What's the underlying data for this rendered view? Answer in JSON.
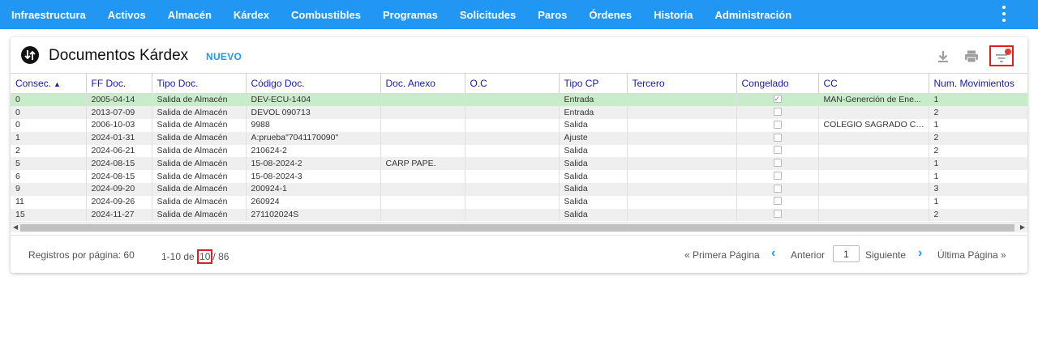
{
  "nav": {
    "items": [
      "Infraestructura",
      "Activos",
      "Almacén",
      "Kárdex",
      "Combustibles",
      "Programas",
      "Solicitudes",
      "Paros",
      "Órdenes",
      "Historia",
      "Administración"
    ]
  },
  "header": {
    "title": "Documentos Kárdex",
    "new_label": "NUEVO"
  },
  "table": {
    "columns": [
      "Consec.",
      "FF Doc.",
      "Tipo Doc.",
      "Código Doc.",
      "Doc. Anexo",
      "O.C",
      "Tipo CP",
      "Tercero",
      "Congelado",
      "CC",
      "Num. Movimientos"
    ],
    "rows": [
      [
        "0",
        "2005-04-14",
        "Salida de Almacén",
        "DEV-ECU-1404",
        "",
        "",
        "Entrada",
        "",
        true,
        "MAN-Generción de Ene...",
        "1"
      ],
      [
        "0",
        "2013-07-09",
        "Salida de Almacén",
        "DEVOL 090713",
        "",
        "",
        "Entrada",
        "",
        false,
        "",
        "2"
      ],
      [
        "0",
        "2006-10-03",
        "Salida de Almacén",
        "9988",
        "",
        "",
        "Salida",
        "",
        false,
        "COLEGIO SAGRADO CO...",
        "1"
      ],
      [
        "1",
        "2024-01-31",
        "Salida de Almacén",
        "A:prueba\"7041170090\"",
        "",
        "",
        "Ajuste",
        "",
        false,
        "",
        "2"
      ],
      [
        "2",
        "2024-06-21",
        "Salida de Almacén",
        "210624-2",
        "",
        "",
        "Salida",
        "",
        false,
        "",
        "2"
      ],
      [
        "5",
        "2024-08-15",
        "Salida de Almacén",
        "15-08-2024-2",
        "CARP PAPE.",
        "",
        "Salida",
        "",
        false,
        "",
        "1"
      ],
      [
        "6",
        "2024-08-15",
        "Salida de Almacén",
        "15-08-2024-3",
        "",
        "",
        "Salida",
        "",
        false,
        "",
        "1"
      ],
      [
        "9",
        "2024-09-20",
        "Salida de Almacén",
        "200924-1",
        "",
        "",
        "Salida",
        "",
        false,
        "",
        "3"
      ],
      [
        "11",
        "2024-09-26",
        "Salida de Almacén",
        "260924",
        "",
        "",
        "Salida",
        "",
        false,
        "",
        "1"
      ],
      [
        "15",
        "2024-11-27",
        "Salida de Almacén",
        "271102024S",
        "",
        "",
        "Salida",
        "",
        false,
        "",
        "2"
      ]
    ]
  },
  "pager": {
    "per_page": "Registros por página: 60",
    "range_start": "1-10 de ",
    "range_highlight": "10",
    "range_end": "/ 86",
    "first": "« Primera Página",
    "prev": "Anterior",
    "page": "1",
    "next": "Siguiente",
    "last": "Última Página »"
  },
  "colors": {
    "primary": "#2196f3",
    "header_text": "#1a1aa6",
    "selected_row": "#c8ebca",
    "highlight": "#e02020"
  }
}
